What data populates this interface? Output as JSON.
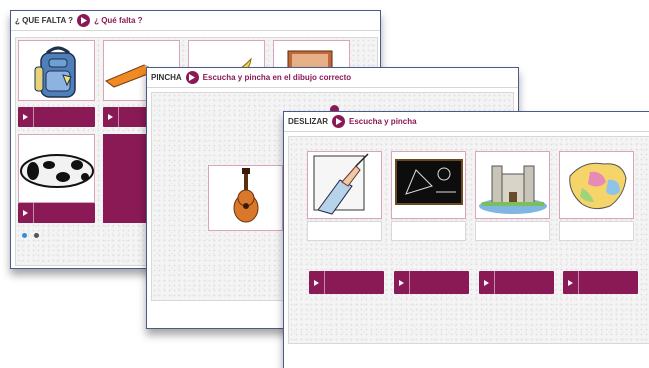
{
  "cards": {
    "back": {
      "label": "¿ QUE FALTA ?",
      "title": "¿ Qué falta ?",
      "items": [
        "backpack-image",
        "pencil-image",
        "banana-image",
        "laptop-image",
        "pencil-case-image"
      ],
      "pagination": {
        "active": 1,
        "total": 2
      }
    },
    "middle": {
      "label": "PINCHA",
      "title": "Escucha y pincha en el dibujo correcto",
      "items": [
        "guitar-image"
      ]
    },
    "front": {
      "label": "DESLIZAR",
      "title": "Escucha y pincha",
      "items": [
        "writing-hand-image",
        "blackboard-image",
        "castle-image",
        "map-image"
      ]
    }
  },
  "colors": {
    "accent": "#8a1a55",
    "tile_border": "#d9a5bb",
    "card_border": "#4a5a8a",
    "dot_active": "#2f8fd8",
    "dot_inactive": "#555555"
  }
}
